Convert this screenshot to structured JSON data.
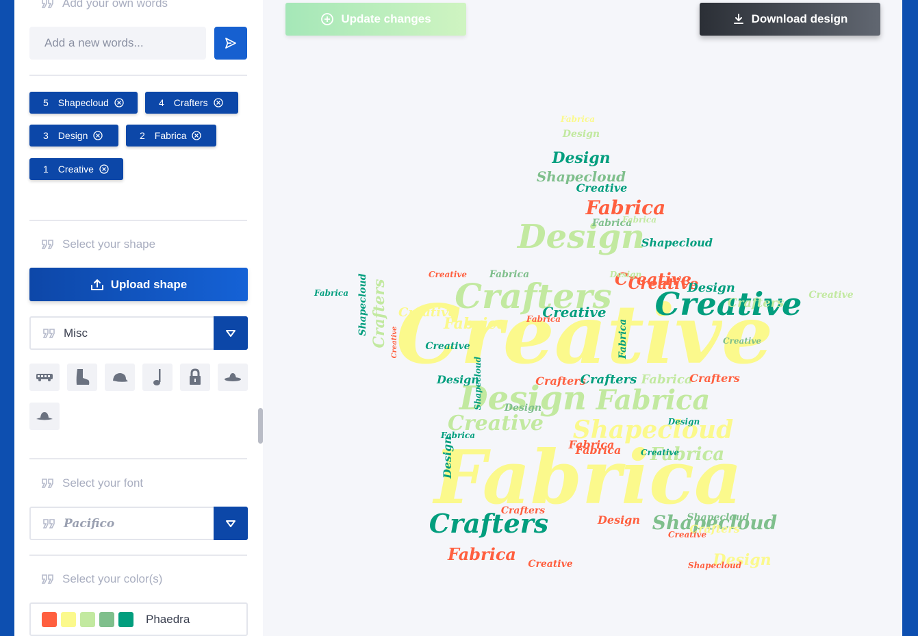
{
  "sidebar": {
    "add_words": {
      "heading": "Add your own words",
      "placeholder": "Add a new words..."
    },
    "words": [
      {
        "weight": "5",
        "text": "Shapecloud"
      },
      {
        "weight": "4",
        "text": "Crafters"
      },
      {
        "weight": "3",
        "text": "Design"
      },
      {
        "weight": "2",
        "text": "Fabrica"
      },
      {
        "weight": "1",
        "text": "Creative"
      }
    ],
    "shape": {
      "heading": "Select your shape",
      "upload_label": "Upload shape",
      "category": "Misc",
      "icons": [
        "bus-icon",
        "boot-icon",
        "cap-icon",
        "music-note-icon",
        "padlock-icon",
        "hat-icon",
        "sombrero-icon"
      ]
    },
    "font": {
      "heading": "Select your font",
      "value": "Pacifico"
    },
    "color": {
      "heading": "Select your color(s)",
      "palette_name": "Phaedra",
      "swatches": [
        "#ff5f3f",
        "#fbf98c",
        "#c2e9a0",
        "#7fbf8c",
        "#029e7e"
      ]
    }
  },
  "main": {
    "update_label": "Update changes",
    "download_label": "Download design",
    "cloud_words": [
      "Shapecloud",
      "Crafters",
      "Design",
      "Fabrica",
      "Creative"
    ]
  },
  "colors": {
    "brand_blue": "#0c47a8",
    "page_background": "#0d4fb0"
  }
}
